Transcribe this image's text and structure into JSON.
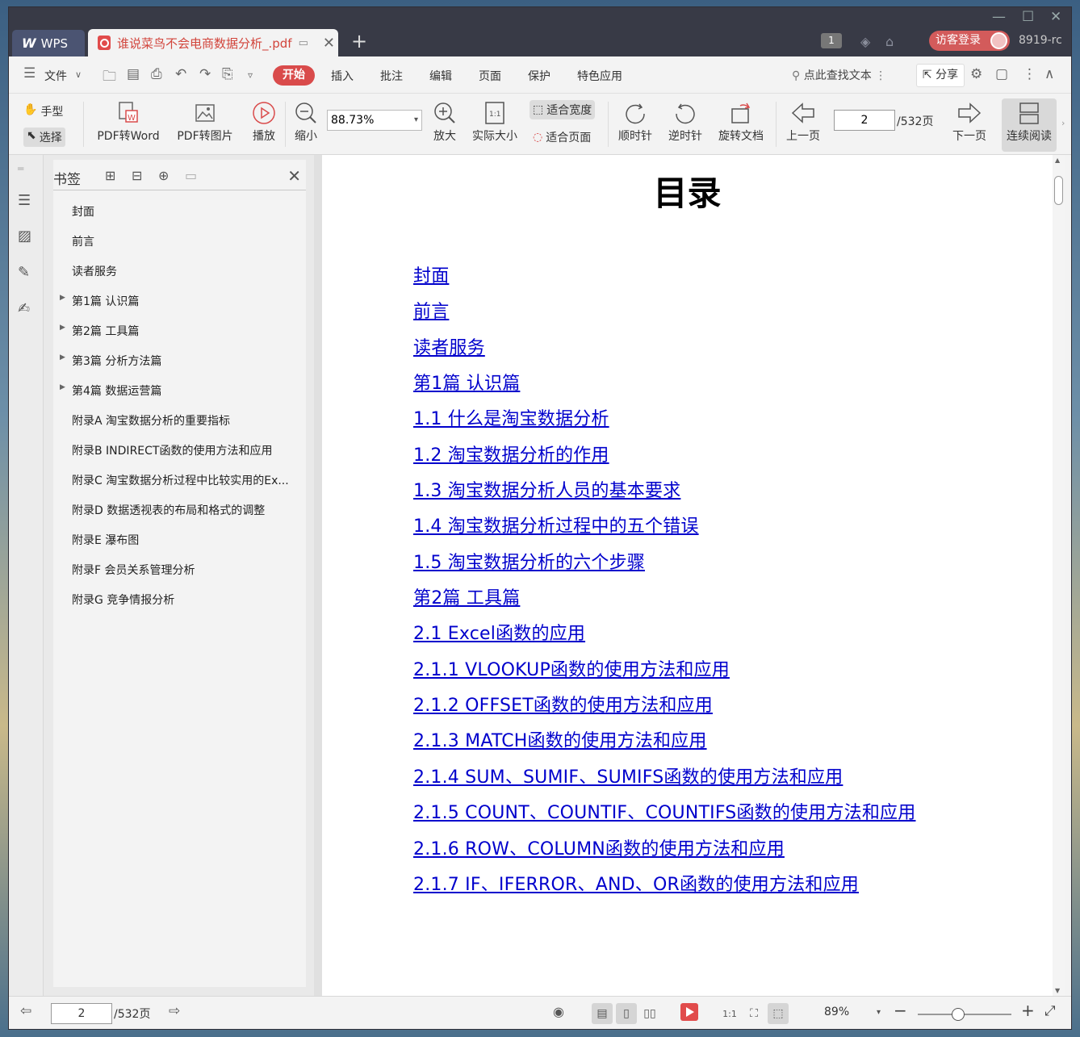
{
  "titlebar": {
    "app_tab": "WPS",
    "doc_tab": "谁说菜鸟不会电商数据分析_.pdf",
    "badge_count": "1",
    "guest_login": "访客登录",
    "user_id": "8919-rc"
  },
  "menu": {
    "file": "文件",
    "start": "开始",
    "insert": "插入",
    "annotate": "批注",
    "edit": "编辑",
    "page": "页面",
    "protect": "保护",
    "special": "特色应用",
    "search": "点此查找文本",
    "share": "分享"
  },
  "ribbon": {
    "hand": "手型",
    "select": "选择",
    "pdf_to_word": "PDF转Word",
    "pdf_to_image": "PDF转图片",
    "play": "播放",
    "zoom_out": "缩小",
    "zoom_value": "88.73%",
    "zoom_in": "放大",
    "actual_size": "实际大小",
    "fit_width": "适合宽度",
    "fit_page": "适合页面",
    "clockwise": "顺时针",
    "counter_clockwise": "逆时针",
    "rotate_doc": "旋转文档",
    "prev_page": "上一页",
    "page_input": "2",
    "page_total": "/532页",
    "next_page": "下一页",
    "continuous": "连续阅读"
  },
  "bookmarks": {
    "title": "书签",
    "items": [
      {
        "label": "封面",
        "expandable": false
      },
      {
        "label": "前言",
        "expandable": false
      },
      {
        "label": "读者服务",
        "expandable": false
      },
      {
        "label": "第1篇 认识篇",
        "expandable": true
      },
      {
        "label": "第2篇 工具篇",
        "expandable": true
      },
      {
        "label": "第3篇 分析方法篇",
        "expandable": true
      },
      {
        "label": "第4篇 数据运营篇",
        "expandable": true
      },
      {
        "label": "附录A 淘宝数据分析的重要指标",
        "expandable": false
      },
      {
        "label": "附录B INDIRECT函数的使用方法和应用",
        "expandable": false
      },
      {
        "label": "附录C 淘宝数据分析过程中比较实用的Ex...",
        "expandable": false
      },
      {
        "label": "附录D 数据透视表的布局和格式的调整",
        "expandable": false
      },
      {
        "label": "附录E 瀑布图",
        "expandable": false
      },
      {
        "label": "附录F 会员关系管理分析",
        "expandable": false
      },
      {
        "label": "附录G 竞争情报分析",
        "expandable": false
      }
    ]
  },
  "document": {
    "title": "目录",
    "toc": [
      "封面",
      "前言",
      "读者服务",
      "第1篇 认识篇",
      "1.1 什么是淘宝数据分析",
      "1.2 淘宝数据分析的作用",
      "1.3 淘宝数据分析人员的基本要求",
      "1.4 淘宝数据分析过程中的五个错误",
      "1.5 淘宝数据分析的六个步骤",
      "第2篇 工具篇",
      "2.1 Excel函数的应用",
      "2.1.1 VLOOKUP函数的使用方法和应用",
      "2.1.2 OFFSET函数的使用方法和应用",
      "2.1.3 MATCH函数的使用方法和应用",
      "2.1.4 SUM、SUMIF、SUMIFS函数的使用方法和应用",
      "2.1.5 COUNT、COUNTIF、COUNTIFS函数的使用方法和应用",
      "2.1.6 ROW、COLUMN函数的使用方法和应用",
      "2.1.7 IF、IFERROR、AND、OR函数的使用方法和应用"
    ]
  },
  "statusbar": {
    "page_input": "2",
    "page_total": "/532页",
    "zoom": "89%"
  }
}
